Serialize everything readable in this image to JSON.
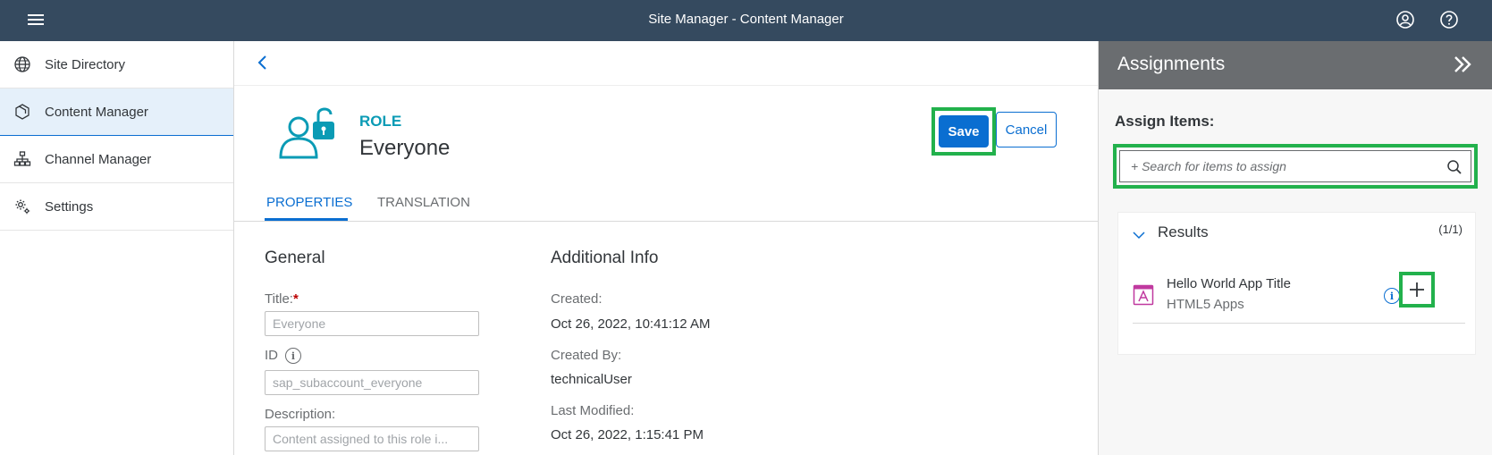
{
  "shell": {
    "title": "Site Manager - Content Manager",
    "menu_icon": "hamburger-menu-icon",
    "user_icon": "user-account-icon",
    "help_icon": "help-icon"
  },
  "sidebar": {
    "items": [
      {
        "label": "Site Directory",
        "icon": "globe-icon"
      },
      {
        "label": "Content Manager",
        "icon": "package-icon"
      },
      {
        "label": "Channel Manager",
        "icon": "hierarchy-icon"
      },
      {
        "label": "Settings",
        "icon": "gear-icon"
      }
    ],
    "active_index": 1
  },
  "header": {
    "kind": "ROLE",
    "name": "Everyone",
    "save_label": "Save",
    "cancel_label": "Cancel"
  },
  "tabs": [
    {
      "label": "PROPERTIES",
      "active": true
    },
    {
      "label": "TRANSLATION",
      "active": false
    }
  ],
  "general": {
    "section_title": "General",
    "title_label": "Title:",
    "title_required_mark": "*",
    "title_placeholder": "Everyone",
    "id_label": "ID",
    "id_value": "sap_subaccount_everyone",
    "description_label": "Description:",
    "description_value": "Content assigned to this role i..."
  },
  "additional": {
    "section_title": "Additional Info",
    "created_label": "Created:",
    "created_value": "Oct 26, 2022, 10:41:12 AM",
    "created_by_label": "Created By:",
    "created_by_value": "technicalUser",
    "last_modified_label": "Last Modified:",
    "last_modified_value": "Oct 26, 2022, 1:15:41 PM"
  },
  "assignments": {
    "title": "Assignments",
    "assign_items_label": "Assign Items:",
    "search_placeholder": "+ Search for items to assign",
    "results_title": "Results",
    "results_count": "(1/1)",
    "items": [
      {
        "name": "Hello World App Title",
        "type": "HTML5 Apps",
        "icon": "html5-app-icon"
      }
    ]
  },
  "colors": {
    "shell_bg": "#354a5f",
    "accent": "#0a6ed1",
    "role_teal": "#0a9bb5",
    "highlight_box": "#22b14c",
    "panel_header": "#6a6d70"
  }
}
